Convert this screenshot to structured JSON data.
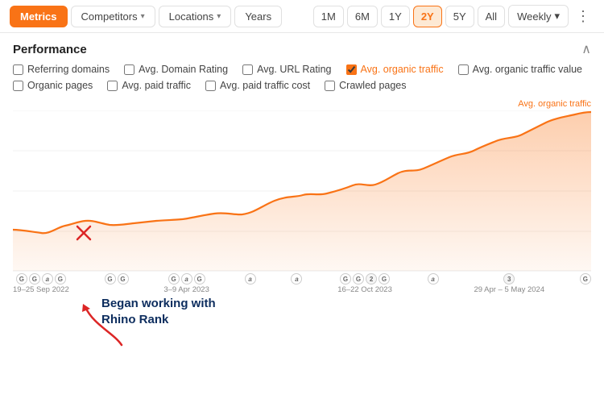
{
  "topNav": {
    "metrics_label": "Metrics",
    "competitors_label": "Competitors",
    "locations_label": "Locations",
    "years_label": "Years",
    "time_buttons": [
      "1M",
      "6M",
      "1Y",
      "2Y",
      "5Y",
      "All"
    ],
    "active_time": "2Y",
    "weekly_label": "Weekly",
    "more_icon": "⋮"
  },
  "performance": {
    "title": "Performance",
    "chart_legend_label": "Avg. organic traffic",
    "metrics": [
      {
        "id": "referring-domains",
        "label": "Referring domains",
        "checked": false,
        "highlighted": false
      },
      {
        "id": "avg-domain-rating",
        "label": "Avg. Domain Rating",
        "checked": false,
        "highlighted": false
      },
      {
        "id": "avg-url-rating",
        "label": "Avg. URL Rating",
        "checked": false,
        "highlighted": false
      },
      {
        "id": "avg-organic-traffic",
        "label": "Avg. organic traffic",
        "checked": true,
        "highlighted": true
      },
      {
        "id": "avg-organic-traffic-value",
        "label": "Avg. organic traffic value",
        "checked": false,
        "highlighted": false
      },
      {
        "id": "organic-pages",
        "label": "Organic pages",
        "checked": false,
        "highlighted": false
      },
      {
        "id": "avg-paid-traffic",
        "label": "Avg. paid traffic",
        "checked": false,
        "highlighted": false
      },
      {
        "id": "avg-paid-traffic-cost",
        "label": "Avg. paid traffic cost",
        "checked": false,
        "highlighted": false
      },
      {
        "id": "crawled-pages",
        "label": "Crawled pages",
        "checked": false,
        "highlighted": false
      }
    ]
  },
  "xAxis": {
    "labels": [
      {
        "icons": [
          "G",
          "G",
          "a",
          "G"
        ],
        "date": "19–25 Sep 2022"
      },
      {
        "icons": [
          "G",
          "G"
        ],
        "date": ""
      },
      {
        "icons": [
          "G",
          "a",
          "G"
        ],
        "date": "3–9 Apr 2023"
      },
      {
        "icons": [
          "a"
        ],
        "date": ""
      },
      {
        "icons": [
          "a"
        ],
        "date": ""
      },
      {
        "icons": [
          "G",
          "G",
          "2",
          "G"
        ],
        "date": "16–22 Oct 2023"
      },
      {
        "icons": [
          "a"
        ],
        "date": ""
      },
      {
        "icons": [
          "3"
        ],
        "date": "29 Apr – 5 May 2024"
      },
      {
        "icons": [
          "G"
        ],
        "date": ""
      }
    ]
  },
  "annotation": {
    "text_line1": "Began working with",
    "text_line2": "Rhino Rank"
  },
  "colors": {
    "orange": "#f97316",
    "orange_light": "#fdba74",
    "orange_fill": "#fde9d4",
    "navy": "#0d2d5e",
    "red": "#dc2626"
  }
}
